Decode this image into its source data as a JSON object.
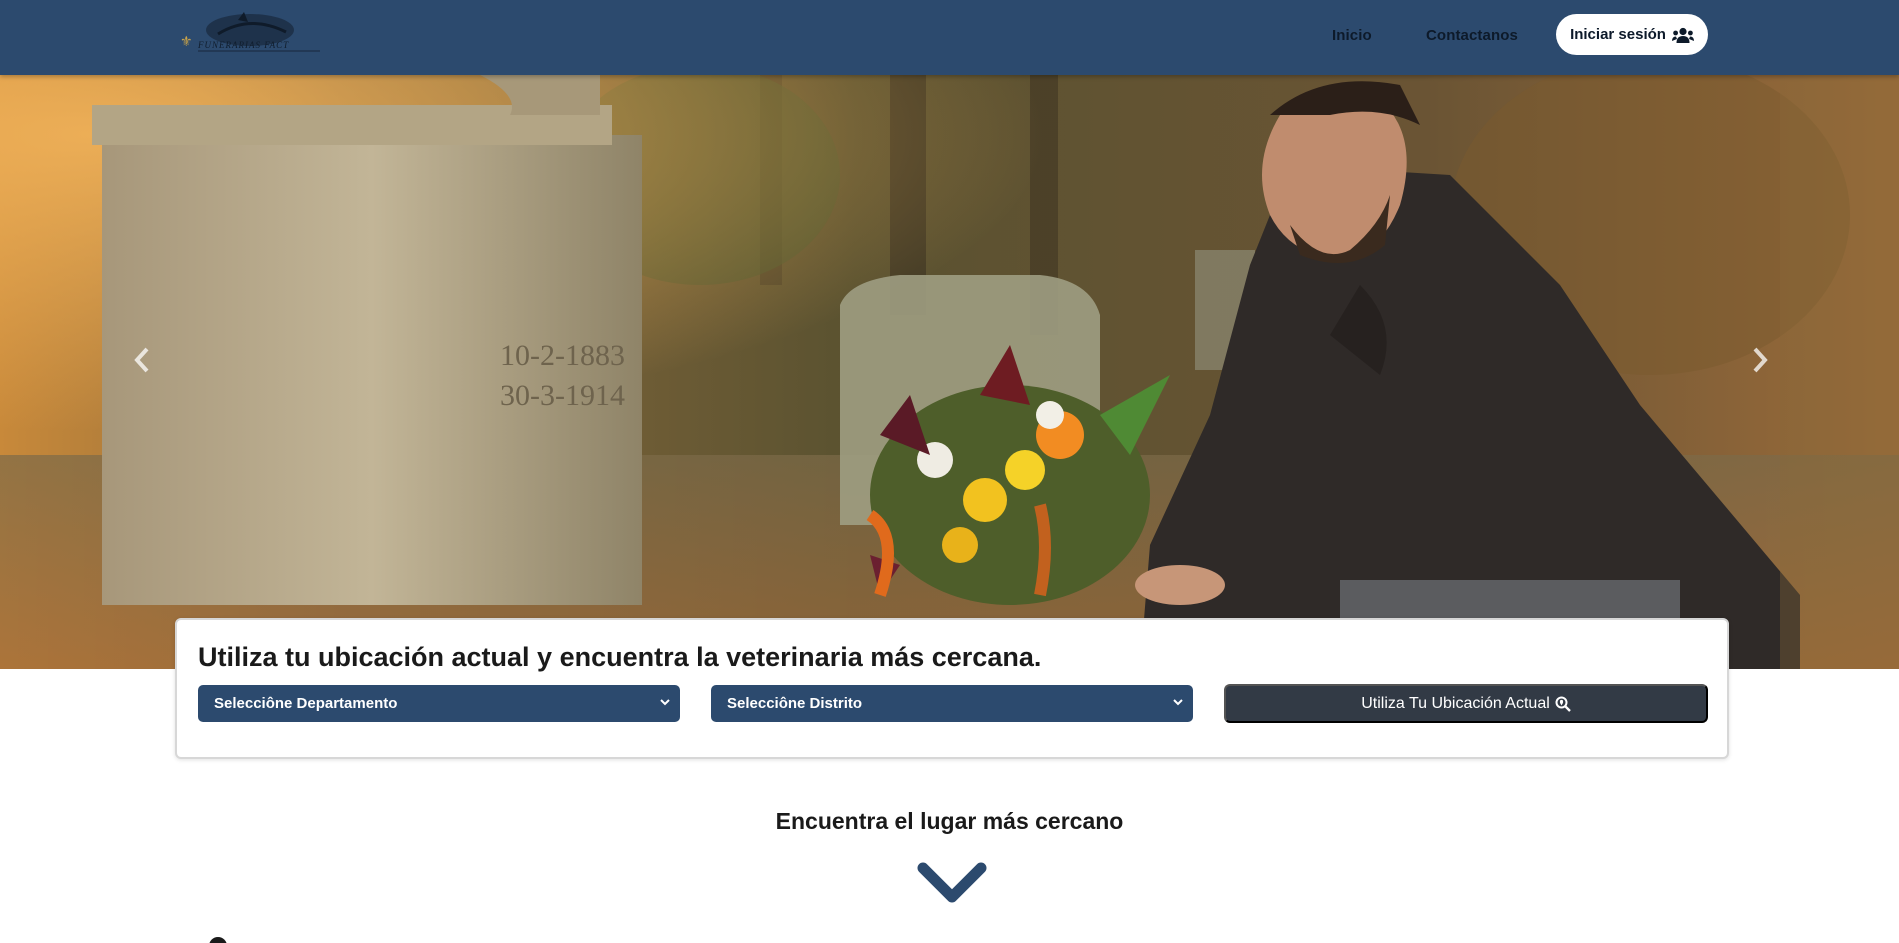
{
  "nav": {
    "logo_text": "FUNERARIAS FACT",
    "links": {
      "inicio": "Inicio",
      "contactanos": "Contactanos"
    },
    "login_label": "Iniciar sesión",
    "login_icon": "users-icon"
  },
  "hero": {
    "prev_icon": "chevron-left-icon",
    "next_icon": "chevron-right-icon",
    "tombstone_engraving": [
      "10-2-1883",
      "30-3-1914"
    ]
  },
  "search": {
    "heading": "Utiliza tu ubicación actual y encuentra la veterinaria más cercana.",
    "departamento_value": "Selecciône Departamento",
    "distrito_value": "Selecciône Distrito",
    "location_button_label": "Utiliza Tu Ubicación Actual",
    "location_button_icon": "search-location-icon"
  },
  "section": {
    "title": "Encuentra el lugar más cercano",
    "arrow_icon": "chevron-down-icon"
  },
  "colors": {
    "navbar": "#2c4a6e",
    "select_bg": "#2c4a6e",
    "button_dark": "#323a45"
  }
}
